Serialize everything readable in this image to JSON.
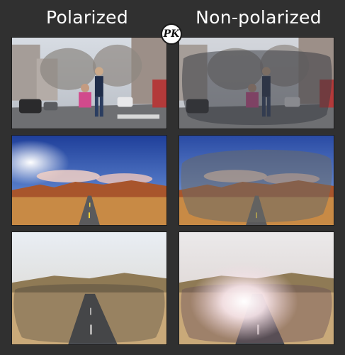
{
  "headers": {
    "left": "Polarized",
    "right": "Non-polarized"
  },
  "badge": "PK",
  "colors": {
    "background": "#303030",
    "header_text": "#ffffff",
    "badge_bg": "#ffffff"
  },
  "rows": [
    {
      "scene": "street"
    },
    {
      "scene": "desert-road"
    },
    {
      "scene": "sunny-road"
    }
  ]
}
